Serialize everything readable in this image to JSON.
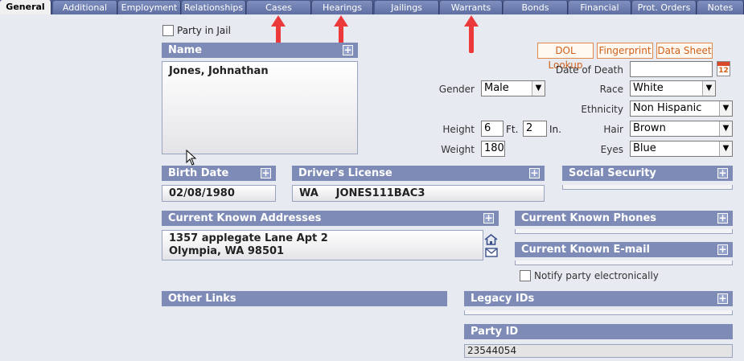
{
  "tabs": [
    "General",
    "Additional",
    "Employment",
    "Relationships",
    "Cases",
    "Hearings",
    "Jailings",
    "Warrants",
    "Bonds",
    "Financial",
    "Prot. Orders",
    "Notes"
  ],
  "party_in_jail_label": "Party in Jail",
  "name_panel": {
    "title": "Name",
    "value": "Jones, Johnathan"
  },
  "buttons": {
    "dol_lookup": "DOL Lookup",
    "fingerprint": "Fingerprint",
    "data_sheet": "Data Sheet"
  },
  "fields": {
    "date_of_death_label": "Date of Death",
    "date_of_death_value": "",
    "gender_label": "Gender",
    "gender_value": "Male",
    "race_label": "Race",
    "race_value": "White",
    "ethnicity_label": "Ethnicity",
    "ethnicity_value": "Non Hispanic",
    "height_label": "Height",
    "height_ft": "6",
    "ft_unit": "Ft.",
    "height_in": "2",
    "in_unit": "In.",
    "hair_label": "Hair",
    "hair_value": "Brown",
    "weight_label": "Weight",
    "weight_value": "180",
    "eyes_label": "Eyes",
    "eyes_value": "Blue"
  },
  "calendar_day": "12",
  "birth_date": {
    "title": "Birth Date",
    "value": "02/08/1980"
  },
  "drivers_license": {
    "title": "Driver's License",
    "state": "WA",
    "number": "JONES111BAC3"
  },
  "social_security": {
    "title": "Social Security"
  },
  "addresses": {
    "title": "Current Known Addresses",
    "line1": "1357 applegate Lane Apt 2",
    "line2": "Olympia, WA 98501"
  },
  "phones": {
    "title": "Current Known Phones"
  },
  "email": {
    "title": "Current Known E-mail"
  },
  "notify_label": "Notify party electronically",
  "other_links": {
    "title": "Other Links"
  },
  "legacy_ids": {
    "title": "Legacy IDs"
  },
  "party_id": {
    "title": "Party ID",
    "value": "23544054"
  },
  "plus_glyph": "+"
}
